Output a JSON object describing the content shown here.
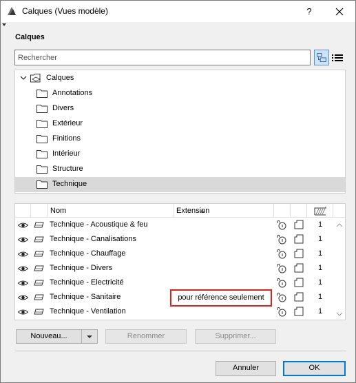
{
  "window": {
    "title": "Calques (Vues modèle)",
    "help_glyph": "?"
  },
  "section_title": "Calques",
  "search": {
    "placeholder": "Rechercher",
    "value": ""
  },
  "tree": {
    "root": "Calques",
    "folders": [
      "Annotations",
      "Divers",
      "Extérieur",
      "Finitions",
      "Intérieur",
      "Structure",
      "Technique"
    ],
    "selected": "Technique"
  },
  "list": {
    "columns": {
      "name": "Nom",
      "extension": "Extension"
    },
    "rows": [
      {
        "name": "Technique - Acoustique & feu",
        "value": "1"
      },
      {
        "name": "Technique - Canalisations",
        "value": "1"
      },
      {
        "name": "Technique - Chauffage",
        "value": "1"
      },
      {
        "name": "Technique - Divers",
        "value": "1"
      },
      {
        "name": "Technique - Electricité",
        "value": "1"
      },
      {
        "name": "Technique - Sanitaire",
        "value": "1",
        "extension": "pour référence seulement"
      },
      {
        "name": "Technique - Ventilation",
        "value": "1"
      }
    ]
  },
  "buttons": {
    "new": "Nouveau...",
    "rename": "Renommer",
    "delete": "Supprimer...",
    "cancel": "Annuler",
    "ok": "OK"
  },
  "colors": {
    "highlight_border": "#e0201f",
    "selected_row": "#d9d9d9",
    "ok_border": "#0078d7"
  },
  "icons": [
    "app-icon",
    "help-icon",
    "close-icon",
    "tree-view-icon",
    "list-view-icon",
    "chevron-down-icon",
    "folder-icon",
    "eye-icon",
    "layer-icon",
    "lock-icon",
    "document-icon",
    "intersection-group-icon",
    "dropdown-arrow-icon"
  ]
}
